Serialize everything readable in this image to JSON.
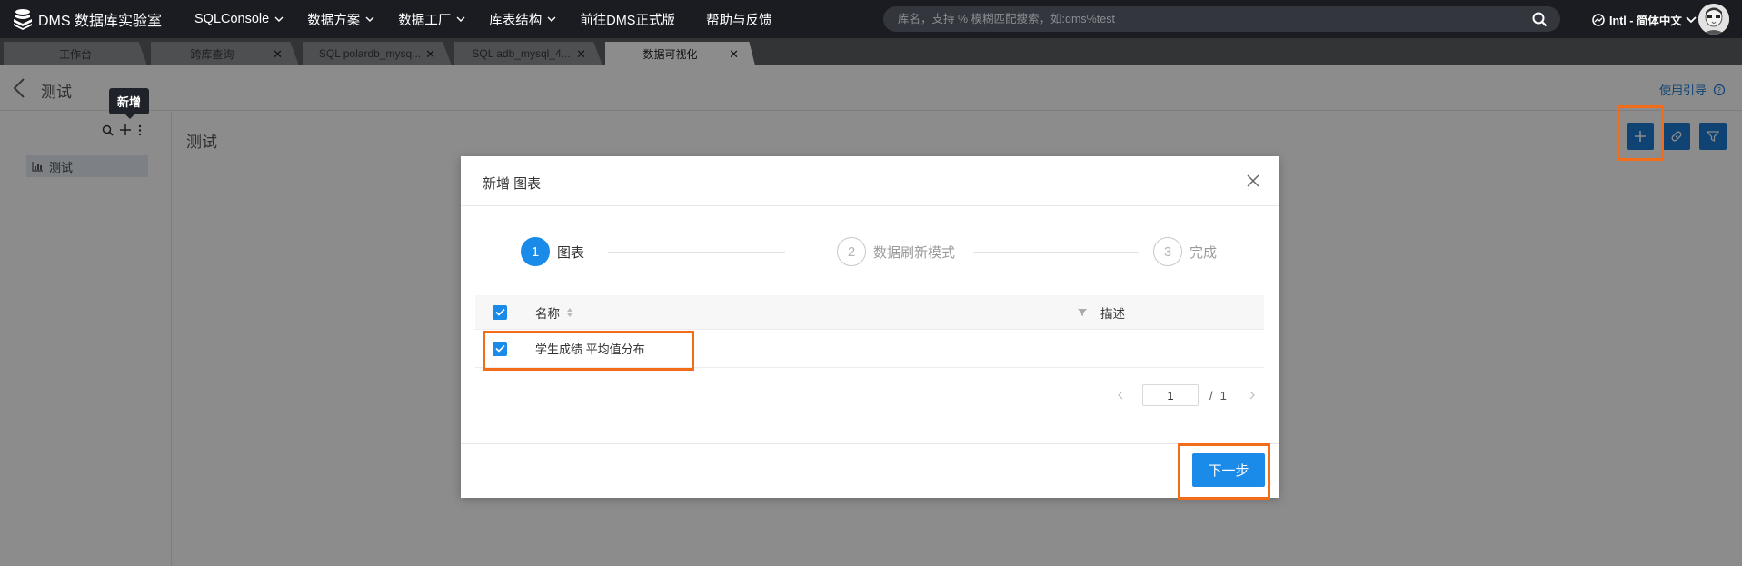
{
  "app": {
    "title": "DMS 数据库实验室",
    "menu": [
      {
        "label": "SQLConsole",
        "dropdown": true
      },
      {
        "label": "数据方案",
        "dropdown": true
      },
      {
        "label": "数据工厂",
        "dropdown": true
      },
      {
        "label": "库表结构",
        "dropdown": true
      },
      {
        "label": "前往DMS正式版",
        "dropdown": false
      },
      {
        "label": "帮助与反馈",
        "dropdown": false
      }
    ],
    "search_placeholder": "库名，支持 % 模糊匹配搜索，如:dms%test",
    "locale": "Intl - 简体中文"
  },
  "tabs": [
    {
      "label": "工作台",
      "closable": false
    },
    {
      "label": "跨库查询",
      "closable": true
    },
    {
      "label": "SQL polardb_mysq...",
      "closable": true
    },
    {
      "label": "SQL adb_mysql_4...",
      "closable": true
    },
    {
      "label": "数据可视化",
      "closable": true,
      "active": true
    }
  ],
  "page": {
    "title": "测试",
    "guide": "使用引导",
    "tooltip": "新增",
    "sidebar_item": "测试",
    "main_title": "测试"
  },
  "modal": {
    "title": "新增 图表",
    "steps": [
      {
        "num": "1",
        "label": "图表",
        "active": true
      },
      {
        "num": "2",
        "label": "数据刷新模式",
        "active": false
      },
      {
        "num": "3",
        "label": "完成",
        "active": false
      }
    ],
    "columns": {
      "name": "名称",
      "desc": "描述"
    },
    "rows": [
      {
        "name": "学生成绩 平均值分布",
        "desc": "",
        "checked": true
      }
    ],
    "pager": {
      "current": "1",
      "separator": "/",
      "total": "1"
    },
    "next_label": "下一步"
  },
  "colors": {
    "accent": "#1a8be8",
    "highlight": "#f26c1a",
    "topnav": "#1a1c21"
  }
}
